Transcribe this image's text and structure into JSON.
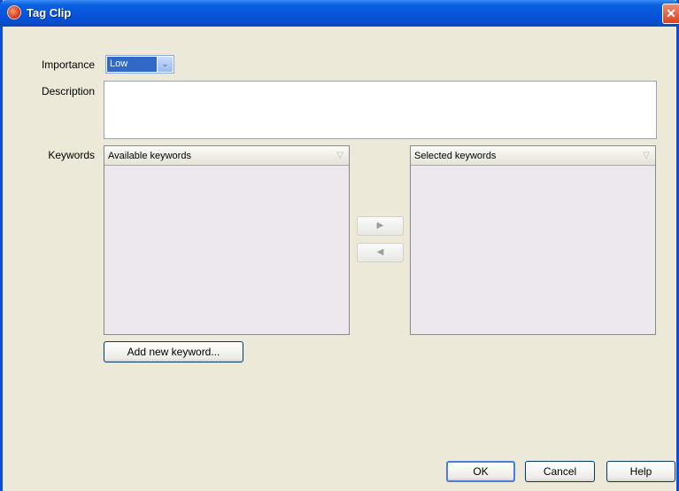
{
  "window": {
    "title": "Tag Clip",
    "close_symbol": "✕"
  },
  "importance": {
    "label": "Importance",
    "selected": "Low",
    "arrow": "⌄"
  },
  "description": {
    "label": "Description",
    "value": ""
  },
  "keywords": {
    "label": "Keywords",
    "available_header": "Available keywords",
    "selected_header": "Selected keywords",
    "sort_symbol": "▽",
    "available_items": [],
    "selected_items": []
  },
  "move_right_symbol": "▶",
  "move_left_symbol": "◀",
  "add_keyword_label": "Add new keyword...",
  "footer": {
    "ok_label": "OK",
    "cancel_label": "Cancel",
    "help_label": "Help"
  },
  "colors": {
    "title_bar": "#0650d8",
    "dialog_bg": "#ece9d8",
    "list_bg": "#ece8ee",
    "selection": "#3268c8"
  }
}
